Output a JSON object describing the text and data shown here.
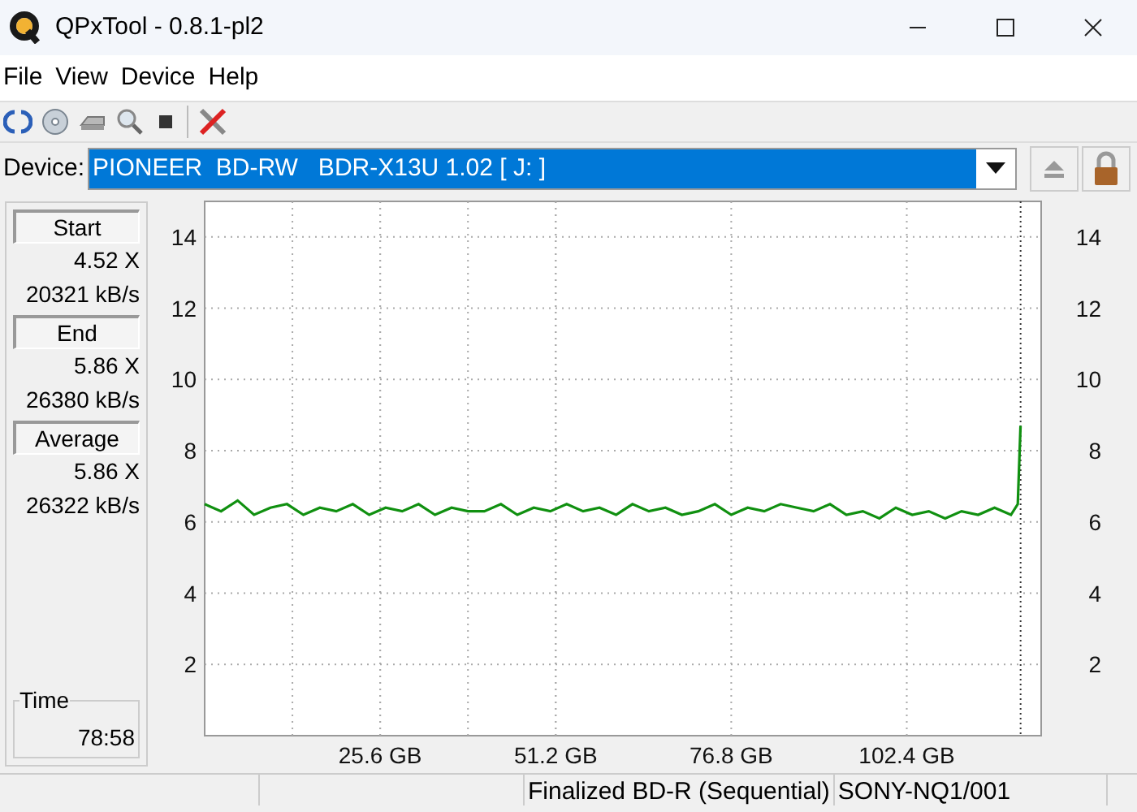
{
  "window": {
    "title": "QPxTool - 0.8.1-pl2"
  },
  "menu": [
    "File",
    "View",
    "Device",
    "Help"
  ],
  "device": {
    "label": "Device:",
    "value": "PIONEER  BD-RW   BDR-X13U 1.02 [ J: ]"
  },
  "stats": [
    {
      "heading": "Start",
      "speed": "4.52 X",
      "rate": "20321 kB/s"
    },
    {
      "heading": "End",
      "speed": "5.86 X",
      "rate": "26380 kB/s"
    },
    {
      "heading": "Average",
      "speed": "5.86 X",
      "rate": "26322 kB/s"
    }
  ],
  "time": {
    "label": "Time",
    "value": "78:58"
  },
  "chart_data": {
    "type": "line",
    "xlim": [
      0,
      122
    ],
    "ylim": [
      0,
      15
    ],
    "xticks": [
      {
        "value": 25.6,
        "label": "25.6 GB"
      },
      {
        "value": 51.2,
        "label": "51.2 GB"
      },
      {
        "value": 76.8,
        "label": "76.8 GB"
      },
      {
        "value": 102.4,
        "label": "102.4 GB"
      }
    ],
    "yticks": [
      2,
      4,
      6,
      8,
      10,
      12,
      14
    ],
    "y2ticks": [
      2,
      4,
      6,
      8,
      10,
      12,
      14
    ],
    "grid": true,
    "y2lim": [
      0,
      15
    ],
    "ref_lines": [
      {
        "axis": "x",
        "value": 119
      }
    ],
    "x": [
      0,
      2.4,
      4.8,
      7.2,
      9.6,
      12,
      14.4,
      16.8,
      19.2,
      21.6,
      24,
      26.4,
      28.8,
      31.2,
      33.6,
      36,
      38.4,
      40.8,
      43.2,
      45.6,
      48,
      50.4,
      52.8,
      55.2,
      57.6,
      60,
      62.4,
      64.8,
      67.2,
      69.6,
      72,
      74.4,
      76.8,
      79.2,
      81.6,
      84,
      86.4,
      88.8,
      91.2,
      93.6,
      96,
      98.4,
      100.8,
      103.2,
      105.6,
      108,
      110.4,
      112.8,
      115.2,
      117.6,
      118.6,
      119
    ],
    "series": [
      {
        "color": "#109010",
        "values": [
          6.5,
          6.3,
          6.6,
          6.2,
          6.4,
          6.5,
          6.2,
          6.4,
          6.3,
          6.5,
          6.2,
          6.4,
          6.3,
          6.5,
          6.2,
          6.4,
          6.3,
          6.3,
          6.5,
          6.2,
          6.4,
          6.3,
          6.5,
          6.3,
          6.4,
          6.2,
          6.5,
          6.3,
          6.4,
          6.2,
          6.3,
          6.5,
          6.2,
          6.4,
          6.3,
          6.5,
          6.4,
          6.3,
          6.5,
          6.2,
          6.3,
          6.1,
          6.4,
          6.2,
          6.3,
          6.1,
          6.3,
          6.2,
          6.4,
          6.2,
          6.5,
          8.7
        ]
      }
    ]
  },
  "status_bar": [
    "Finalized BD-R (Sequential)",
    "SONY-NQ1/001"
  ]
}
